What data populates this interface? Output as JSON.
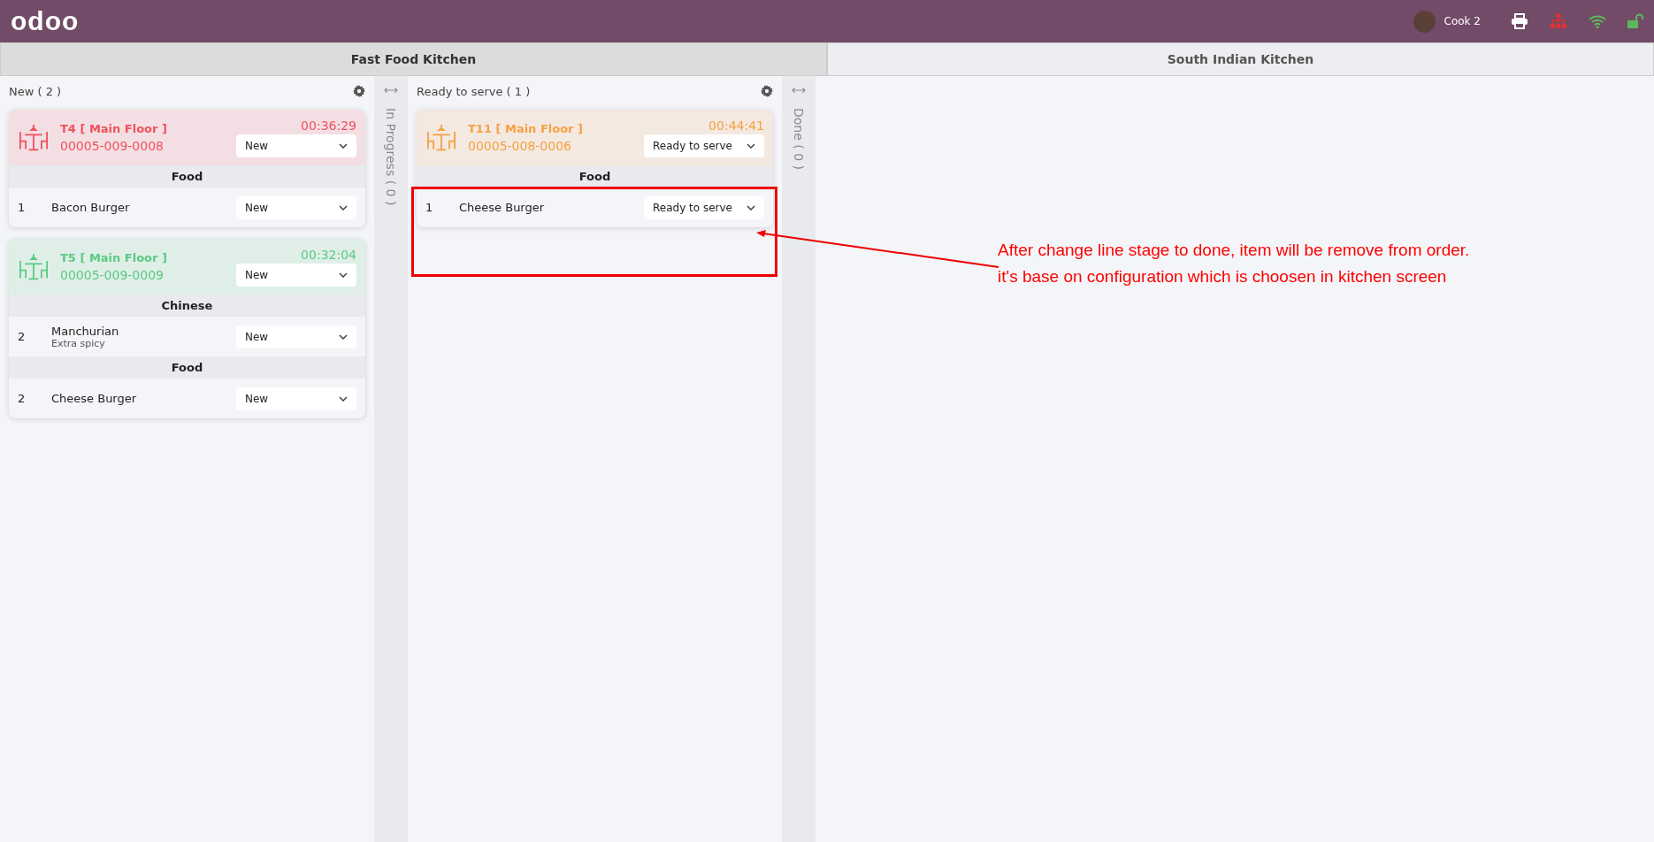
{
  "navbar": {
    "logo": "odoo",
    "user": "Cook 2"
  },
  "kitchens": [
    {
      "label": "Fast Food Kitchen",
      "selected": true
    },
    {
      "label": "South Indian Kitchen",
      "selected": false
    }
  ],
  "stages": [
    {
      "kind": "open",
      "title": "New ( 2 )",
      "orders": [
        {
          "table": "T4 [ Main Floor ]",
          "ref": "00005-009-0008",
          "timer": "00:36:29",
          "color": "#f0505c",
          "stage": "New",
          "groups": [
            {
              "category": "Food",
              "lines": [
                {
                  "qty": "1",
                  "name": "Bacon Burger",
                  "stage": "New"
                }
              ]
            }
          ]
        },
        {
          "table": "T5 [ Main Floor ]",
          "ref": "00005-009-0009",
          "timer": "00:32:04",
          "color": "#5cc983",
          "stage": "New",
          "groups": [
            {
              "category": "Chinese",
              "lines": [
                {
                  "qty": "2",
                  "name": "Manchurian",
                  "note": "Extra spicy",
                  "stage": "New"
                }
              ]
            },
            {
              "category": "Food",
              "lines": [
                {
                  "qty": "2",
                  "name": "Cheese Burger",
                  "stage": "New"
                }
              ]
            }
          ]
        }
      ]
    },
    {
      "kind": "folded",
      "title": "In Progress ( 0 )"
    },
    {
      "kind": "open",
      "title": "Ready to serve ( 1 )",
      "orders": [
        {
          "table": "T11 [ Main Floor ]",
          "ref": "00005-008-0006",
          "timer": "00:44:41",
          "color": "#f5a043",
          "stage": "Ready to serve",
          "groups": [
            {
              "category": "Food",
              "lines": [
                {
                  "qty": "1",
                  "name": "Cheese Burger",
                  "stage": "Ready to serve"
                }
              ]
            }
          ]
        }
      ]
    },
    {
      "kind": "folded",
      "title": "Done ( 0 )"
    }
  ],
  "annotation": {
    "lines": [
      "After change line stage to done, item will be remove from order.",
      "it's base on configuration which is choosen in kitchen screen"
    ]
  }
}
